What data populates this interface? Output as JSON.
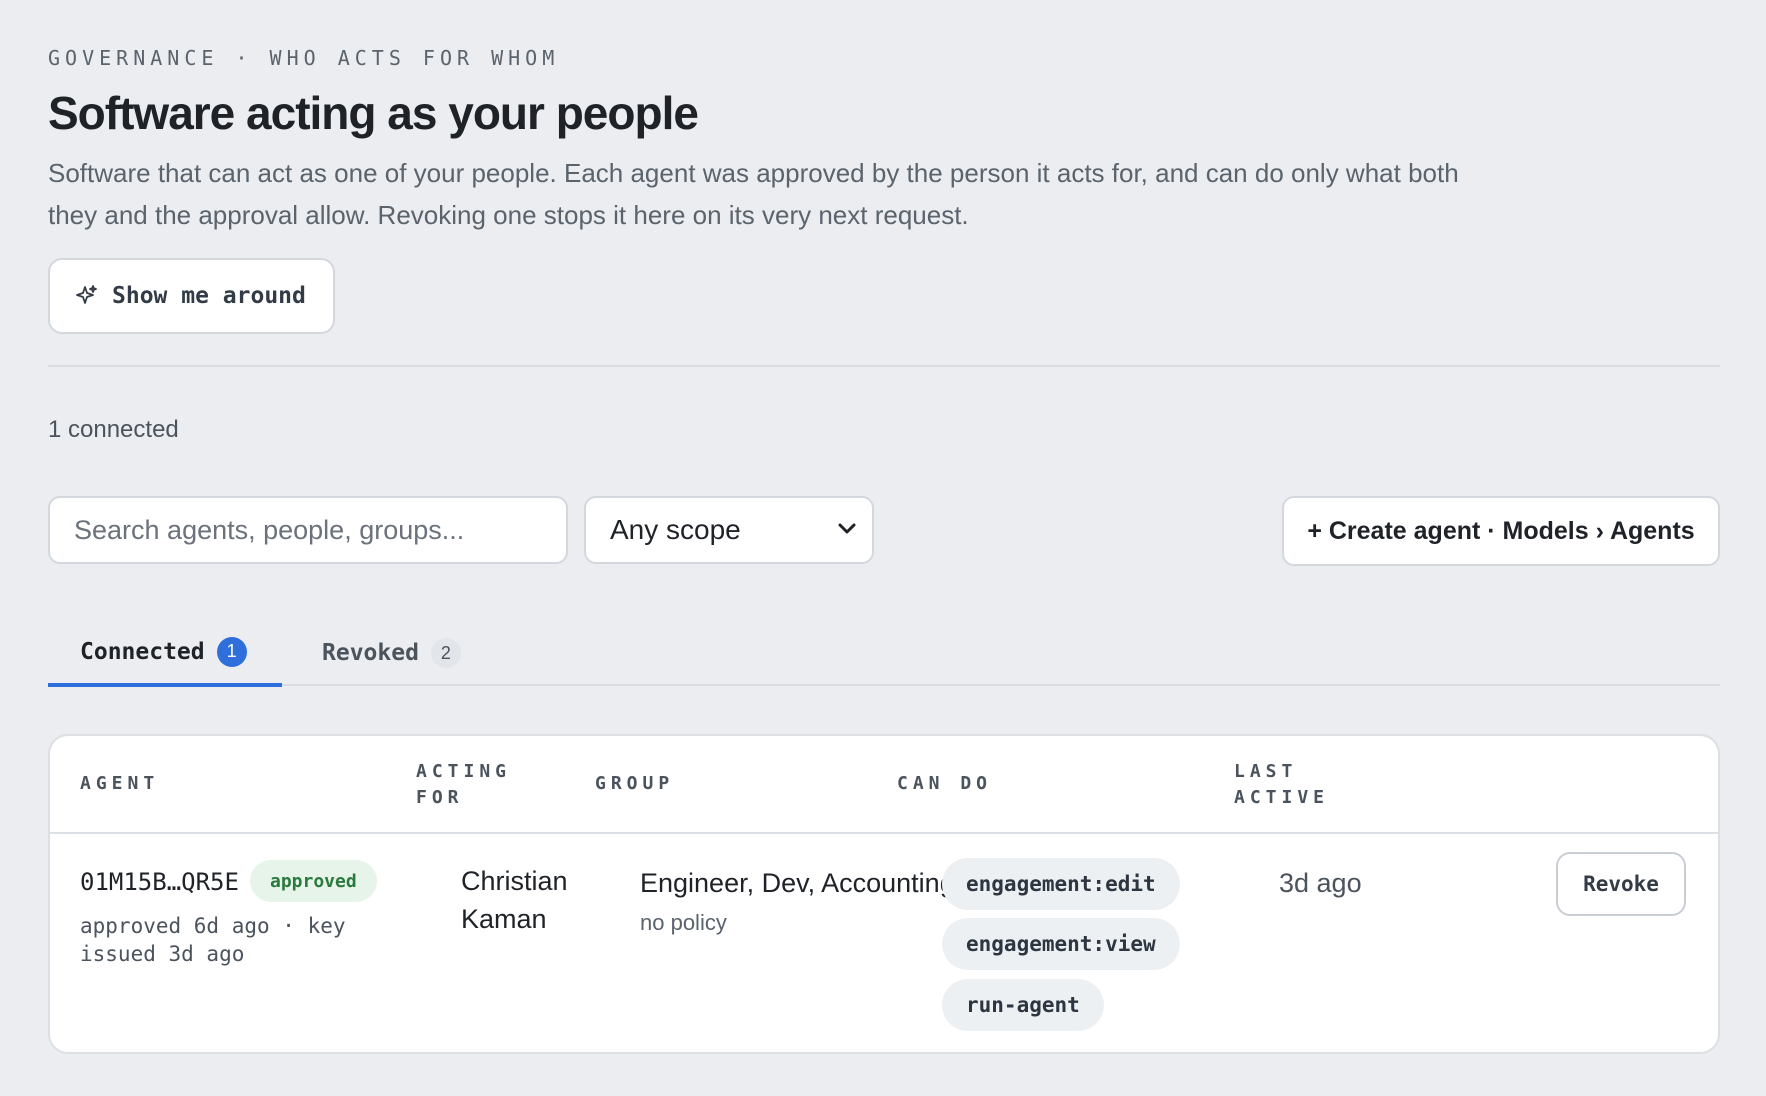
{
  "header": {
    "eyebrow": "GOVERNANCE · WHO ACTS FOR WHOM",
    "title": "Software acting as your people",
    "description": "Software that can act as one of your people. Each agent was approved by the person it acts for, and can do only what both they and the approval allow. Revoking one stops it here on its very next request.",
    "tour_button": {
      "label": "Show me around",
      "icon": "sparkle-icon"
    }
  },
  "summary": {
    "count_text": "1 connected"
  },
  "filters": {
    "search_placeholder": "Search agents, people, groups...",
    "scope_selected": "Any scope",
    "create_button": "+ Create agent · Models › Agents"
  },
  "tabs": [
    {
      "label": "Connected",
      "count": "1",
      "active": true
    },
    {
      "label": "Revoked",
      "count": "2",
      "active": false
    }
  ],
  "table": {
    "columns": {
      "agent": "AGENT",
      "acting_for_1": "ACTING",
      "acting_for_2": "FOR",
      "group": "GROUP",
      "can_do": "CAN DO",
      "last_active_1": "LAST",
      "last_active_2": "ACTIVE"
    },
    "rows": [
      {
        "agent_id": "01M15B…QR5E",
        "status": "approved",
        "meta": "approved 6d ago · key issued 3d ago",
        "acting_for": "Christian Kaman",
        "group": "Engineer, Dev, Accounting",
        "policy": "no policy",
        "scopes": [
          "engagement:edit",
          "engagement:view",
          "run-agent"
        ],
        "last_active": "3d ago",
        "action": "Revoke"
      }
    ]
  },
  "colors": {
    "accent": "#2f6fdb",
    "approved_bg": "#e6f4ea",
    "approved_text": "#2a7a3e",
    "background": "#ebedf0"
  }
}
